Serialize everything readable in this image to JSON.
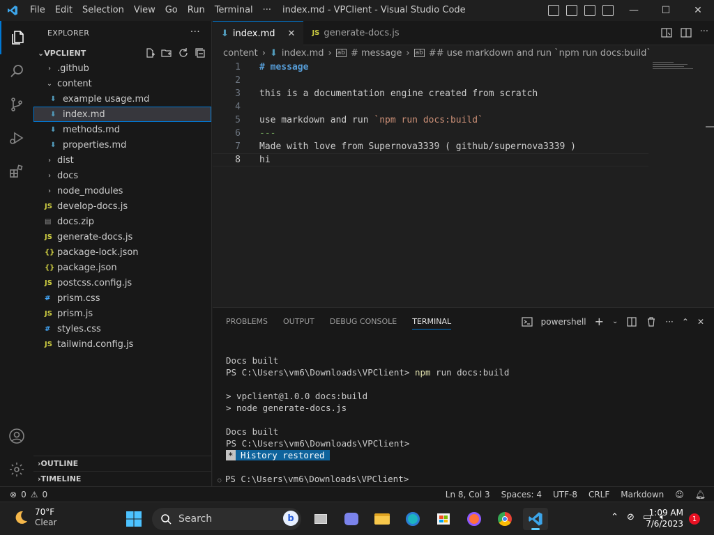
{
  "titlebar": {
    "menu": [
      "File",
      "Edit",
      "Selection",
      "View",
      "Go",
      "Run",
      "Terminal",
      "···"
    ],
    "title": "index.md - VPClient - Visual Studio Code",
    "min": "—",
    "max": "☐",
    "close": "✕"
  },
  "sidebar": {
    "header": "EXPLORER",
    "dots": "···",
    "root": "VPCLIENT",
    "tree": [
      {
        "label": ".github",
        "kind": "folder",
        "depth": 1,
        "open": false
      },
      {
        "label": "content",
        "kind": "folder",
        "depth": 1,
        "open": true
      },
      {
        "label": "example usage.md",
        "kind": "md",
        "depth": 2
      },
      {
        "label": "index.md",
        "kind": "md",
        "depth": 2,
        "selected": true
      },
      {
        "label": "methods.md",
        "kind": "md",
        "depth": 2
      },
      {
        "label": "properties.md",
        "kind": "md",
        "depth": 2
      },
      {
        "label": "dist",
        "kind": "folder",
        "depth": 1,
        "open": false
      },
      {
        "label": "docs",
        "kind": "folder",
        "depth": 1,
        "open": false
      },
      {
        "label": "node_modules",
        "kind": "folder",
        "depth": 1,
        "open": false
      },
      {
        "label": "develop-docs.js",
        "kind": "js",
        "depth": 1
      },
      {
        "label": "docs.zip",
        "kind": "zip",
        "depth": 1
      },
      {
        "label": "generate-docs.js",
        "kind": "js",
        "depth": 1
      },
      {
        "label": "package-lock.json",
        "kind": "json",
        "depth": 1
      },
      {
        "label": "package.json",
        "kind": "json",
        "depth": 1
      },
      {
        "label": "postcss.config.js",
        "kind": "js",
        "depth": 1
      },
      {
        "label": "prism.css",
        "kind": "css",
        "depth": 1
      },
      {
        "label": "prism.js",
        "kind": "js",
        "depth": 1
      },
      {
        "label": "styles.css",
        "kind": "css",
        "depth": 1
      },
      {
        "label": "tailwind.config.js",
        "kind": "js",
        "depth": 1
      }
    ],
    "outline": "OUTLINE",
    "timeline": "TIMELINE"
  },
  "tabs": [
    {
      "label": "index.md",
      "icon": "markdown-icon",
      "active": true,
      "close": "✕"
    },
    {
      "label": "generate-docs.js",
      "icon": "js-icon",
      "active": false
    }
  ],
  "breadcrumb": [
    "content",
    "index.md",
    "# message",
    "## use markdown and run `npm run docs:build`"
  ],
  "editor": {
    "lines": [
      {
        "n": "1",
        "segments": [
          {
            "t": "# message",
            "c": "md-heading"
          }
        ]
      },
      {
        "n": "2",
        "segments": []
      },
      {
        "n": "3",
        "segments": [
          {
            "t": "this is a documentation engine created from scratch",
            "c": ""
          }
        ]
      },
      {
        "n": "4",
        "segments": []
      },
      {
        "n": "5",
        "segments": [
          {
            "t": "use markdown and run ",
            "c": ""
          },
          {
            "t": "`npm run docs:build`",
            "c": "md-code"
          }
        ]
      },
      {
        "n": "6",
        "segments": [
          {
            "t": "---",
            "c": "md-hr"
          }
        ]
      },
      {
        "n": "7",
        "segments": [
          {
            "t": "Made with love from Supernova3339 ( github/supernova3339 )",
            "c": ""
          }
        ]
      },
      {
        "n": "8",
        "segments": [
          {
            "t": "hi",
            "c": ""
          }
        ],
        "current": true
      }
    ]
  },
  "panel": {
    "tabs": [
      "PROBLEMS",
      "OUTPUT",
      "DEBUG CONSOLE",
      "TERMINAL"
    ],
    "active_tab": "TERMINAL",
    "shell": "powershell",
    "terminal": {
      "l1": "Docs built",
      "l2_prompt": "PS C:\\Users\\vm6\\Downloads\\VPClient> ",
      "l2_cmd": "npm",
      "l2_rest": " run docs:build",
      "l3": "> vpclient@1.0.0 docs:build",
      "l4": "> node generate-docs.js",
      "l5": "Docs built",
      "l6": "PS C:\\Users\\vm6\\Downloads\\VPClient>",
      "hist_star": "*",
      "hist_text": " History restored ",
      "prompt": "PS C:\\Users\\vm6\\Downloads\\VPClient>"
    }
  },
  "status": {
    "errors": "0",
    "warnings": "0",
    "position": "Ln 8, Col 3",
    "spaces": "Spaces: 4",
    "encoding": "UTF-8",
    "eol": "CRLF",
    "language": "Markdown"
  },
  "taskbar": {
    "temp": "70°F",
    "condition": "Clear",
    "search": "Search",
    "time": "1:09 AM",
    "date": "7/6/2023",
    "notifications": "1"
  },
  "colors": {
    "accent": "#0078d4",
    "editor_bg": "#1f1f1f",
    "sidebar_bg": "#181818"
  }
}
